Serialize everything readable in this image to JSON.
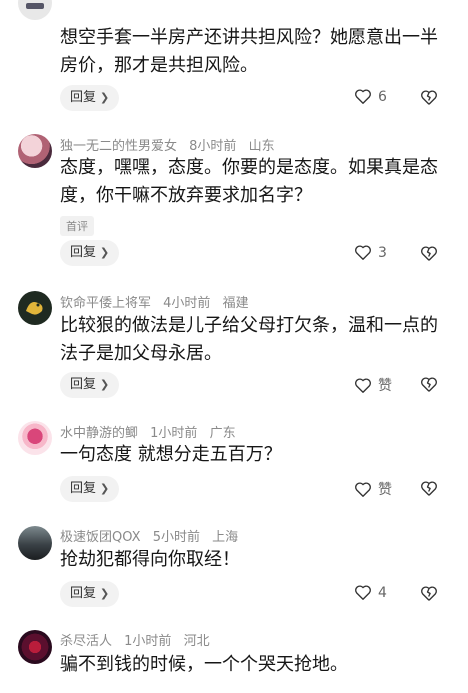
{
  "comments": [
    {
      "meta": {
        "name": "",
        "time": "",
        "location": ""
      },
      "content": "想空手套一半房产还讲共担风险？她愿意出一半房价，那才是共担风险。",
      "tag": "",
      "reply_label": "回复",
      "likes": "6"
    },
    {
      "meta": {
        "name": "独一无二的性男爱女",
        "time": "8小时前",
        "location": "山东"
      },
      "content": "态度，嘿嘿，态度。你要的是态度。如果真是态度，你干嘛不放弃要求加名字？",
      "tag": "首评",
      "reply_label": "回复",
      "likes": "3"
    },
    {
      "meta": {
        "name": "钦命平倭上将军",
        "time": "4小时前",
        "location": "福建"
      },
      "content": "比较狠的做法是儿子给父母打欠条，温和一点的法子是加父母永居。",
      "tag": "",
      "reply_label": "回复",
      "likes": "赞"
    },
    {
      "meta": {
        "name": "水中静游的鲫",
        "time": "1小时前",
        "location": "广东"
      },
      "content": "一句态度 就想分走五百万？",
      "tag": "",
      "reply_label": "回复",
      "likes": "赞"
    },
    {
      "meta": {
        "name": "极速饭团QOX",
        "time": "5小时前",
        "location": "上海"
      },
      "content": "抢劫犯都得向你取经！",
      "tag": "",
      "reply_label": "回复",
      "likes": "4"
    },
    {
      "meta": {
        "name": "杀尽活人",
        "time": "1小时前",
        "location": "河北"
      },
      "content": "骗不到钱的时候，一个个哭天抢地。",
      "tag": "",
      "reply_label": "",
      "likes": ""
    }
  ]
}
